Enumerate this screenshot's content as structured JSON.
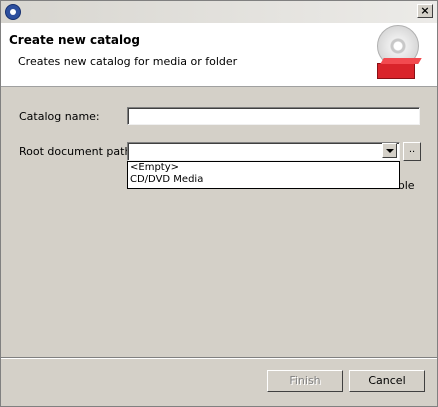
{
  "window": {
    "title": "",
    "close_label": "×",
    "app_icon": "app-icon"
  },
  "banner": {
    "title": "Create new catalog",
    "description": "Creates new catalog for media or folder"
  },
  "form": {
    "catalog_name_label": "Catalog name:",
    "catalog_name_value": "",
    "root_path_label": "Root document path:",
    "root_path_value": "",
    "browse_label": "..",
    "root_path_options": [
      "<Empty>",
      "CD/DVD Media"
    ],
    "obscured_text": "able"
  },
  "footer": {
    "finish_label": "Finish",
    "cancel_label": "Cancel"
  }
}
